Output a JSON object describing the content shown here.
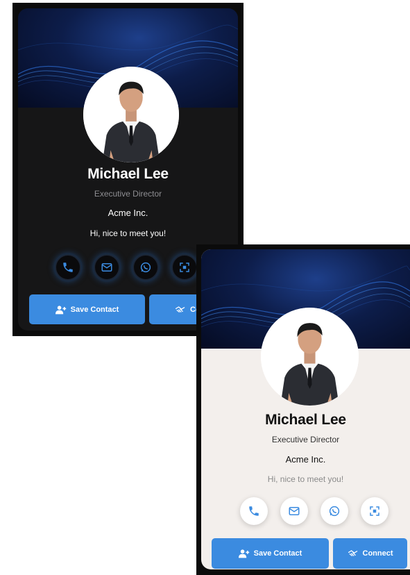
{
  "profile": {
    "name": "Michael Lee",
    "title": "Executive Director",
    "company": "Acme Inc.",
    "greeting": "Hi, nice to meet you!"
  },
  "contact_icons": [
    "phone-icon",
    "mail-icon",
    "whatsapp-icon",
    "qr-code-icon"
  ],
  "actions": {
    "save_label": "Save Contact",
    "connect_label": "Connect"
  },
  "colors": {
    "accent": "#3b8be0",
    "dark_background": "#161617",
    "light_background": "#f3efec",
    "banner": "#0d1d4a"
  }
}
